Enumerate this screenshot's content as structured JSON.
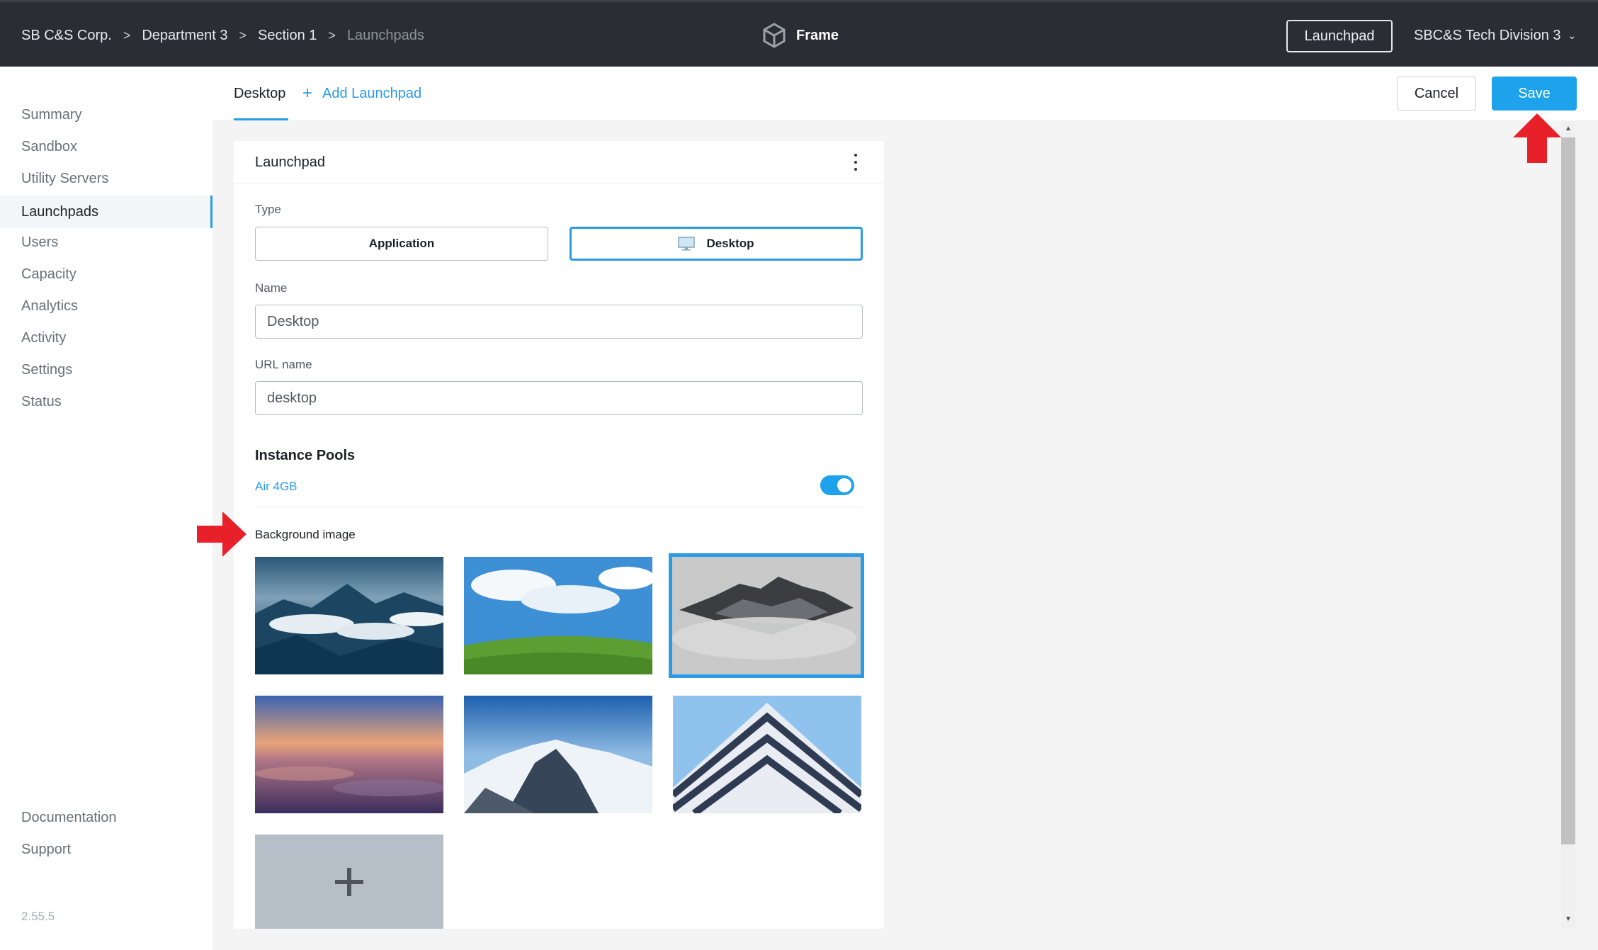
{
  "topbar": {
    "breadcrumbs": [
      "SB C&S Corp.",
      "Department 3",
      "Section 1",
      "Launchpads"
    ],
    "separator": ">",
    "brand": "Frame",
    "launchpad_button": "Launchpad",
    "org_name": "SBC&S Tech Division 3"
  },
  "sidebar": {
    "items": [
      {
        "label": "Summary",
        "active": false
      },
      {
        "label": "Sandbox",
        "active": false
      },
      {
        "label": "Utility Servers",
        "active": false
      },
      {
        "label": "Launchpads",
        "active": true
      },
      {
        "label": "Users",
        "active": false
      },
      {
        "label": "Capacity",
        "active": false
      },
      {
        "label": "Analytics",
        "active": false
      },
      {
        "label": "Activity",
        "active": false
      },
      {
        "label": "Settings",
        "active": false
      },
      {
        "label": "Status",
        "active": false
      }
    ],
    "footer_items": [
      "Documentation",
      "Support"
    ],
    "version": "2.55.5"
  },
  "tabs": {
    "active": "Desktop",
    "add_label": "Add Launchpad",
    "add_icon": "+"
  },
  "actions": {
    "cancel": "Cancel",
    "save": "Save"
  },
  "card": {
    "title": "Launchpad",
    "type_label": "Type",
    "type_options": [
      "Application",
      "Desktop"
    ],
    "type_selected": "Desktop",
    "name_label": "Name",
    "name_value": "Desktop",
    "url_label": "URL name",
    "url_value": "desktop",
    "pools_title": "Instance Pools",
    "pool_name": "Air 4GB",
    "pool_enabled": true,
    "bg_label": "Background image",
    "bg_images": [
      {
        "name": "mountains-clouds-dusk",
        "selected": false
      },
      {
        "name": "green-hill-blue-sky",
        "selected": false
      },
      {
        "name": "misty-mountain-peak",
        "selected": true
      },
      {
        "name": "sunset-over-clouds",
        "selected": false
      },
      {
        "name": "snowy-mountains",
        "selected": false
      },
      {
        "name": "white-building-sky",
        "selected": false
      }
    ],
    "add_image_icon": "+"
  },
  "colors": {
    "accent": "#2a9be6",
    "topbar": "#2a2e34",
    "save": "#1fa2ec",
    "annotation": "#e8202a"
  }
}
